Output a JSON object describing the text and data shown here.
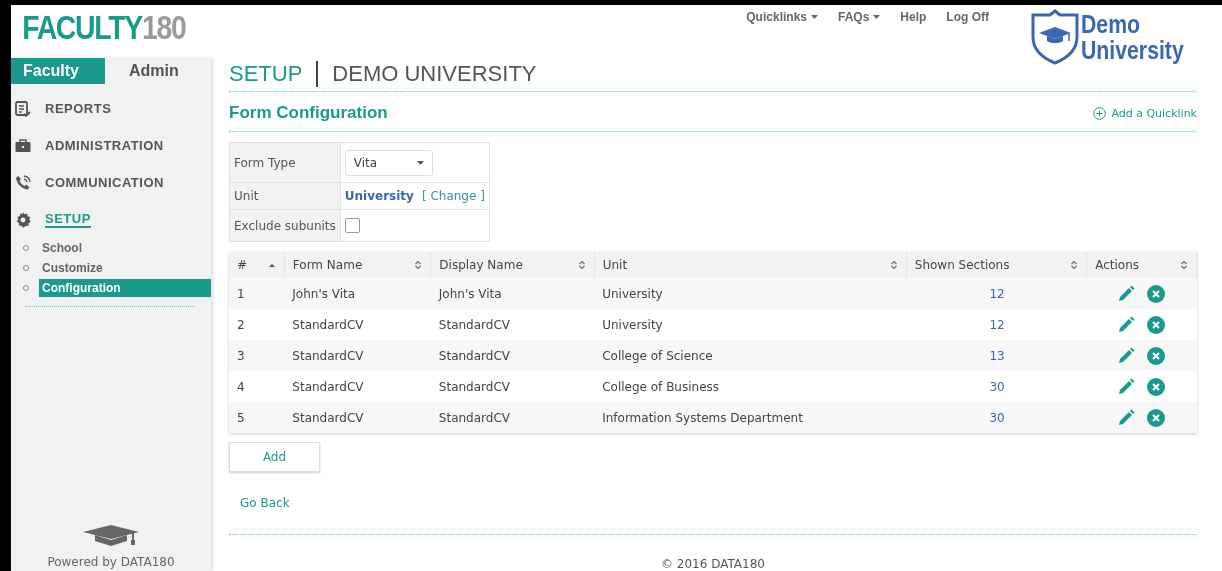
{
  "logo": {
    "text": "FACULTY",
    "number": "180"
  },
  "role_tabs": [
    {
      "label": "Faculty",
      "selected": true
    },
    {
      "label": "Admin",
      "selected": false
    }
  ],
  "sidebar": {
    "items": [
      {
        "label": "REPORTS",
        "selected": false
      },
      {
        "label": "ADMINISTRATION",
        "selected": false
      },
      {
        "label": "COMMUNICATION",
        "selected": false
      },
      {
        "label": "SETUP",
        "selected": true,
        "children": [
          {
            "label": "School",
            "selected": false
          },
          {
            "label": "Customize",
            "selected": false
          },
          {
            "label": "Configuration",
            "selected": true
          }
        ]
      }
    ],
    "footer": "Powered by DATA180"
  },
  "top_nav": [
    {
      "label": "Quicklinks",
      "dropdown": true
    },
    {
      "label": "FAQs",
      "dropdown": true
    },
    {
      "label": "Help",
      "dropdown": false
    },
    {
      "label": "Log Off",
      "dropdown": false
    }
  ],
  "university_logo": {
    "line1": "Demo",
    "line2": "University"
  },
  "breadcrumb": {
    "section": "SETUP",
    "school": "DEMO UNIVERSITY"
  },
  "page_title": "Form Configuration",
  "add_quicklink": "Add a Quicklink",
  "filters": {
    "form_type_label": "Form Type",
    "form_type_value": "Vita",
    "unit_label": "Unit",
    "unit_value": "University",
    "change_link": "[ Change ]",
    "exclude_label": "Exclude subunits",
    "exclude_checked": false
  },
  "table": {
    "columns": [
      {
        "label": "#",
        "sorted": true
      },
      {
        "label": "Form Name",
        "sorted": false
      },
      {
        "label": "Display Name",
        "sorted": false
      },
      {
        "label": "Unit",
        "sorted": false
      },
      {
        "label": "Shown Sections",
        "sorted": false
      },
      {
        "label": "Actions",
        "sorted": false
      }
    ],
    "rows": [
      {
        "num": "1",
        "form_name": "John's Vita",
        "display_name": "John's Vita",
        "unit": "University",
        "sections": "12"
      },
      {
        "num": "2",
        "form_name": "StandardCV",
        "display_name": "StandardCV",
        "unit": "University",
        "sections": "12"
      },
      {
        "num": "3",
        "form_name": "StandardCV",
        "display_name": "StandardCV",
        "unit": "College of Science",
        "sections": "13"
      },
      {
        "num": "4",
        "form_name": "StandardCV",
        "display_name": "StandardCV",
        "unit": "College of Business",
        "sections": "30"
      },
      {
        "num": "5",
        "form_name": "StandardCV",
        "display_name": "StandardCV",
        "unit": "Information Systems Department",
        "sections": "30"
      }
    ]
  },
  "add_button": "Add",
  "go_back": "Go Back",
  "footer": "© 2016 DATA180"
}
